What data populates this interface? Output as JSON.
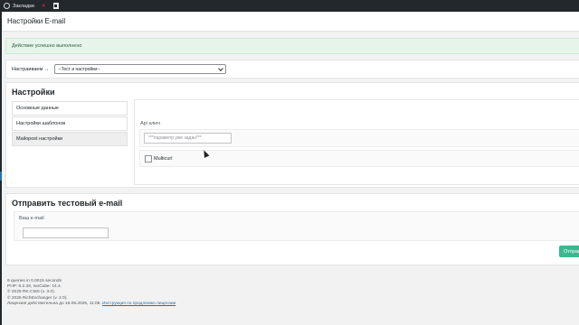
{
  "topbar": {
    "bookmarks_label": "Закладки"
  },
  "header": {
    "title": "Настройки E-mail"
  },
  "notice": {
    "text": "Действие успешно выполнено"
  },
  "config": {
    "label": "Настраиваем →",
    "selected": "--Тест и настройки--"
  },
  "settings": {
    "title": "Настройки",
    "tabs": [
      {
        "label": "Основные данные"
      },
      {
        "label": "Настройки шаблонов"
      },
      {
        "label": "Mailopost настройки",
        "active": true
      }
    ],
    "api_label": "Api ключ",
    "api_placeholder": "***параметр уже задан***",
    "multicurl_label": "Multicurl"
  },
  "test_email": {
    "title": "Отправить тестовый e-mail",
    "email_label": "Ваш e-mail",
    "email_value": "",
    "send_label": "Отправить"
  },
  "footer": {
    "lines": [
      "9 queries in 0.0015 seconds",
      "PHP: 8.2.28, IonCube: 14.4.",
      "© 2025 RK-CMS (v. 3.0).",
      "© 2025 RichExchanger (v. 2.0)."
    ],
    "license_text": "Лицензия действительна до 16.08.2025, 11:08.",
    "license_link": "Инструкция по продлению лицензии"
  },
  "colors": {
    "topbar": "#23282d",
    "notice_bg": "#e6f4ea",
    "send_button": "#3bb88f",
    "link": "#2271b1"
  }
}
